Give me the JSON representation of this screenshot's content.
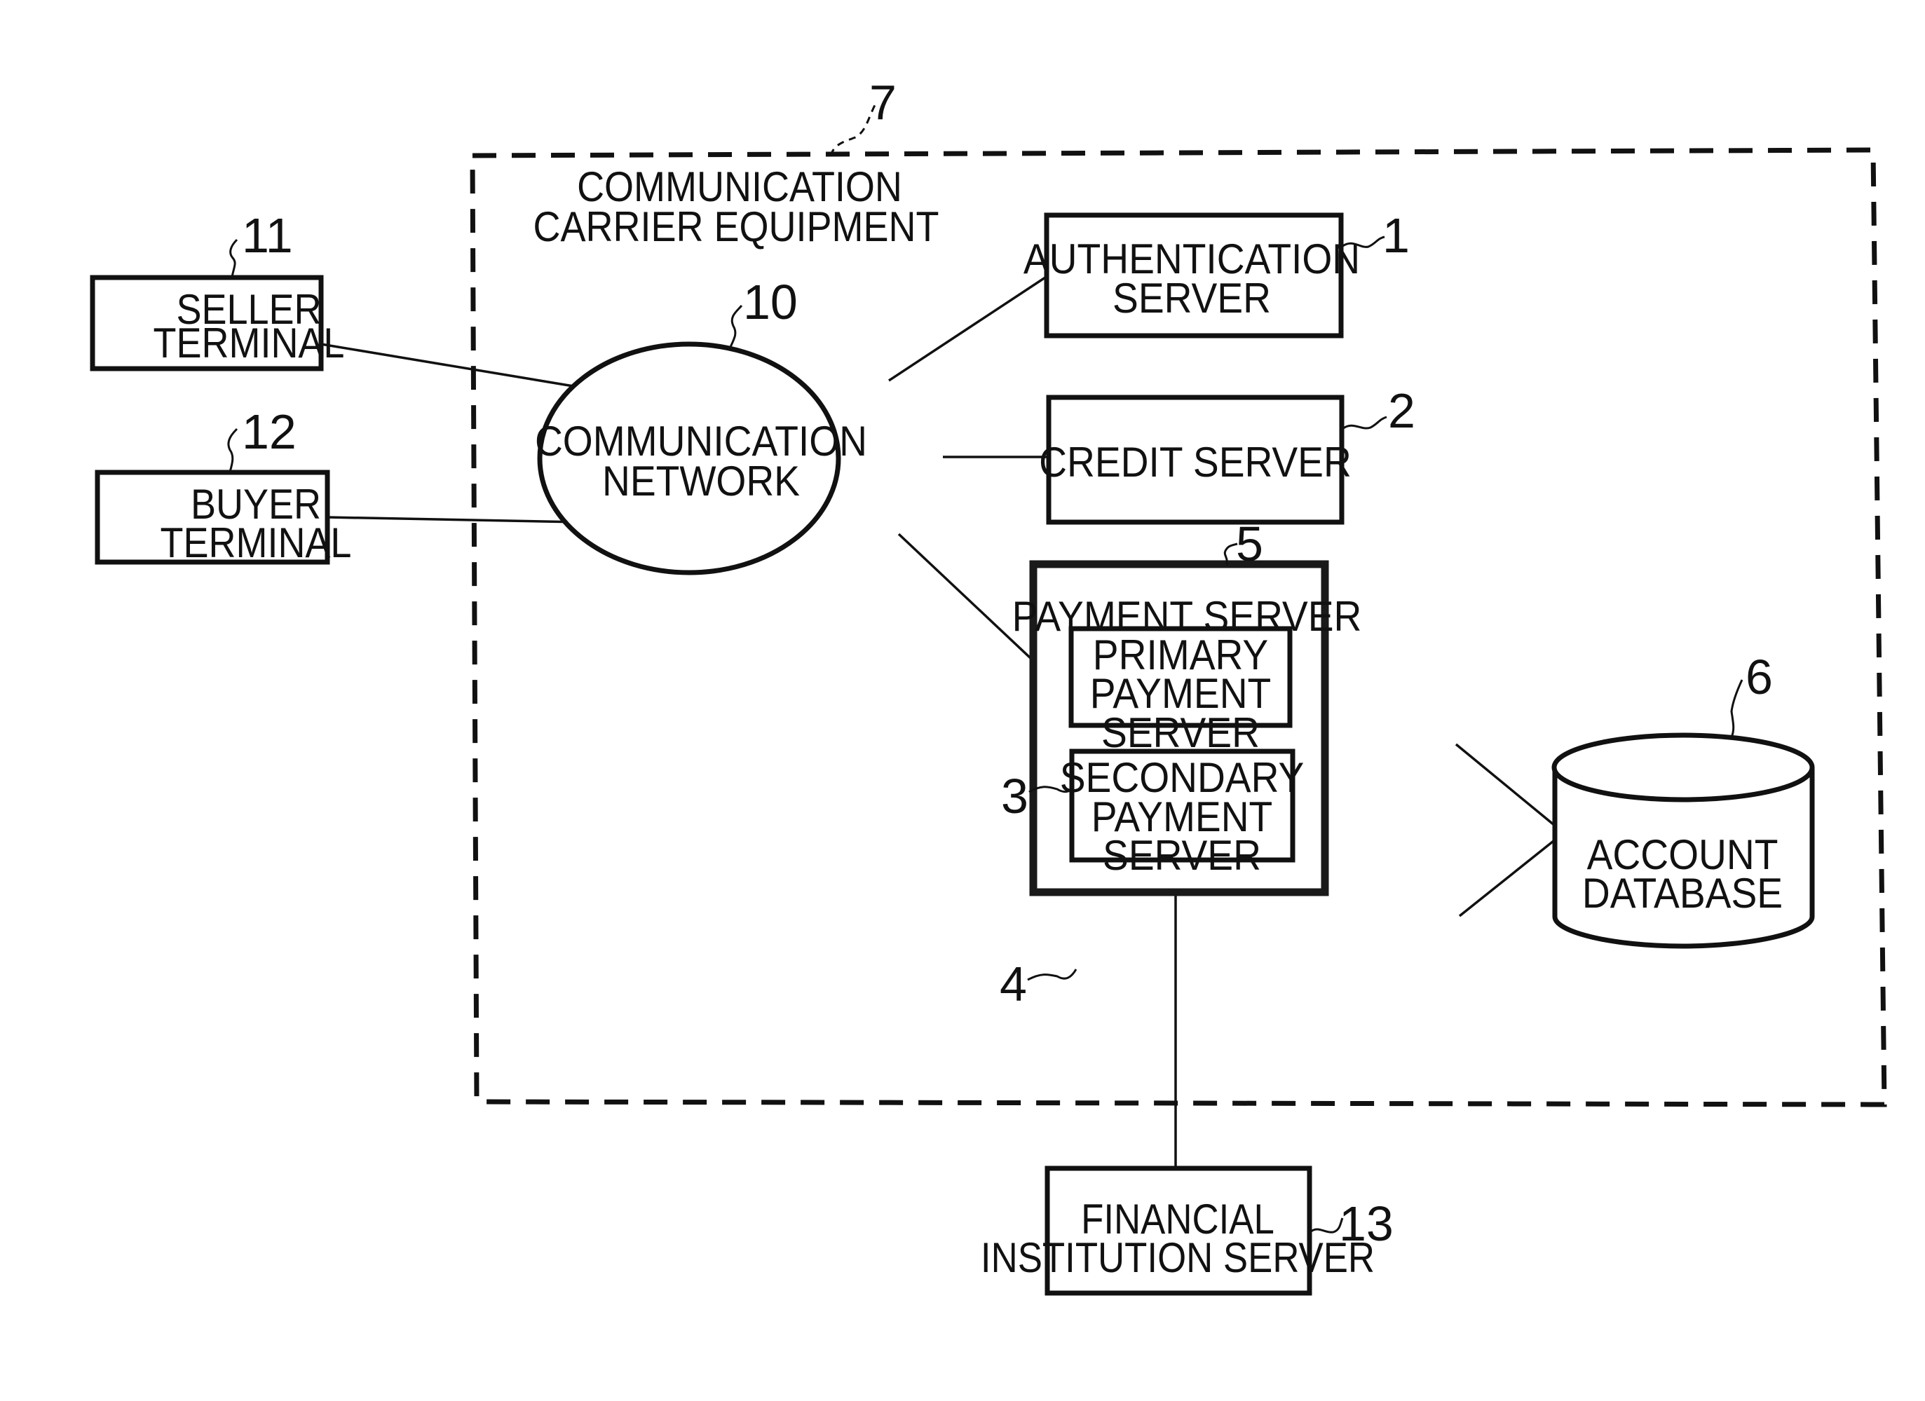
{
  "figure": {
    "group": {
      "ref": "7",
      "title_lines": [
        "COMMUNICATION",
        "CARRIER EQUIPMENT"
      ]
    },
    "nodes": {
      "seller": {
        "ref": "11",
        "lines": [
          "SELLER",
          "TERMINAL"
        ]
      },
      "buyer": {
        "ref": "12",
        "lines": [
          "BUYER",
          "TERMINAL"
        ]
      },
      "network": {
        "ref": "10",
        "lines": [
          "COMMUNICATION",
          "NETWORK"
        ]
      },
      "auth": {
        "ref": "1",
        "lines": [
          "AUTHENTICATION",
          "SERVER"
        ]
      },
      "credit": {
        "ref": "2",
        "lines": [
          "CREDIT SERVER"
        ]
      },
      "payment": {
        "ref": "5",
        "lines": [
          "PAYMENT SERVER"
        ]
      },
      "primary": {
        "ref": "3",
        "lines": [
          "PRIMARY",
          "PAYMENT",
          "SERVER"
        ]
      },
      "secondary": {
        "ref": "4",
        "lines": [
          "SECONDARY",
          "PAYMENT",
          "SERVER"
        ]
      },
      "database": {
        "ref": "6",
        "lines": [
          "ACCOUNT",
          "DATABASE"
        ]
      },
      "financial": {
        "ref": "13",
        "lines": [
          "FINANCIAL",
          "INSTITUTION SERVER"
        ]
      }
    },
    "connections": [
      [
        "seller",
        "network"
      ],
      [
        "buyer",
        "network"
      ],
      [
        "network",
        "auth"
      ],
      [
        "network",
        "credit"
      ],
      [
        "network",
        "primary"
      ],
      [
        "primary",
        "database"
      ],
      [
        "secondary",
        "database"
      ],
      [
        "payment",
        "financial"
      ]
    ]
  }
}
